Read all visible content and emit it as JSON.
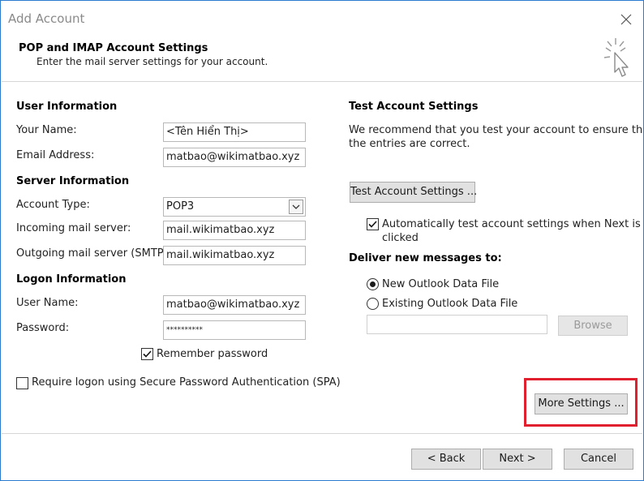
{
  "window": {
    "title": "Add Account",
    "close_icon": "close-icon"
  },
  "header": {
    "title": "POP and IMAP Account Settings",
    "subtitle": "Enter the mail server settings for your account.",
    "icon": "wizard-cursor-icon"
  },
  "user_info": {
    "heading": "User Information",
    "name_label": "Your Name:",
    "name_value": "<Tên Hiển Thị>",
    "email_label": "Email Address:",
    "email_value": "matbao@wikimatbao.xyz"
  },
  "server_info": {
    "heading": "Server Information",
    "account_type_label": "Account Type:",
    "account_type_value": "POP3",
    "incoming_label": "Incoming mail server:",
    "incoming_value": "mail.wikimatbao.xyz",
    "outgoing_label": "Outgoing mail server (SMTP):",
    "outgoing_value": "mail.wikimatbao.xyz"
  },
  "logon_info": {
    "heading": "Logon Information",
    "username_label": "User Name:",
    "username_value": "matbao@wikimatbao.xyz",
    "password_label": "Password:",
    "password_value": "**********",
    "remember_label": "Remember password",
    "remember_checked": true,
    "spa_label": "Require logon using Secure Password Authentication (SPA)",
    "spa_checked": false
  },
  "test_settings": {
    "heading": "Test Account Settings",
    "description_line1": "We recommend that you test your account to ensure that",
    "description_line2": "the entries are correct.",
    "test_button": "Test Account Settings ...",
    "auto_test_line1": "Automatically test account settings when Next is",
    "auto_test_line2": "clicked",
    "auto_test_checked": true
  },
  "deliver": {
    "heading": "Deliver new messages to:",
    "option_new": "New Outlook Data File",
    "option_existing": "Existing Outlook Data File",
    "selected": "new",
    "existing_path_value": "",
    "browse_button": "Browse"
  },
  "more_settings_button": "More Settings ...",
  "footer": {
    "back_button": "< Back",
    "next_button": "Next >",
    "cancel_button": "Cancel"
  },
  "colors": {
    "highlight": "#e0202e",
    "window_border": "#2b7bd1"
  }
}
